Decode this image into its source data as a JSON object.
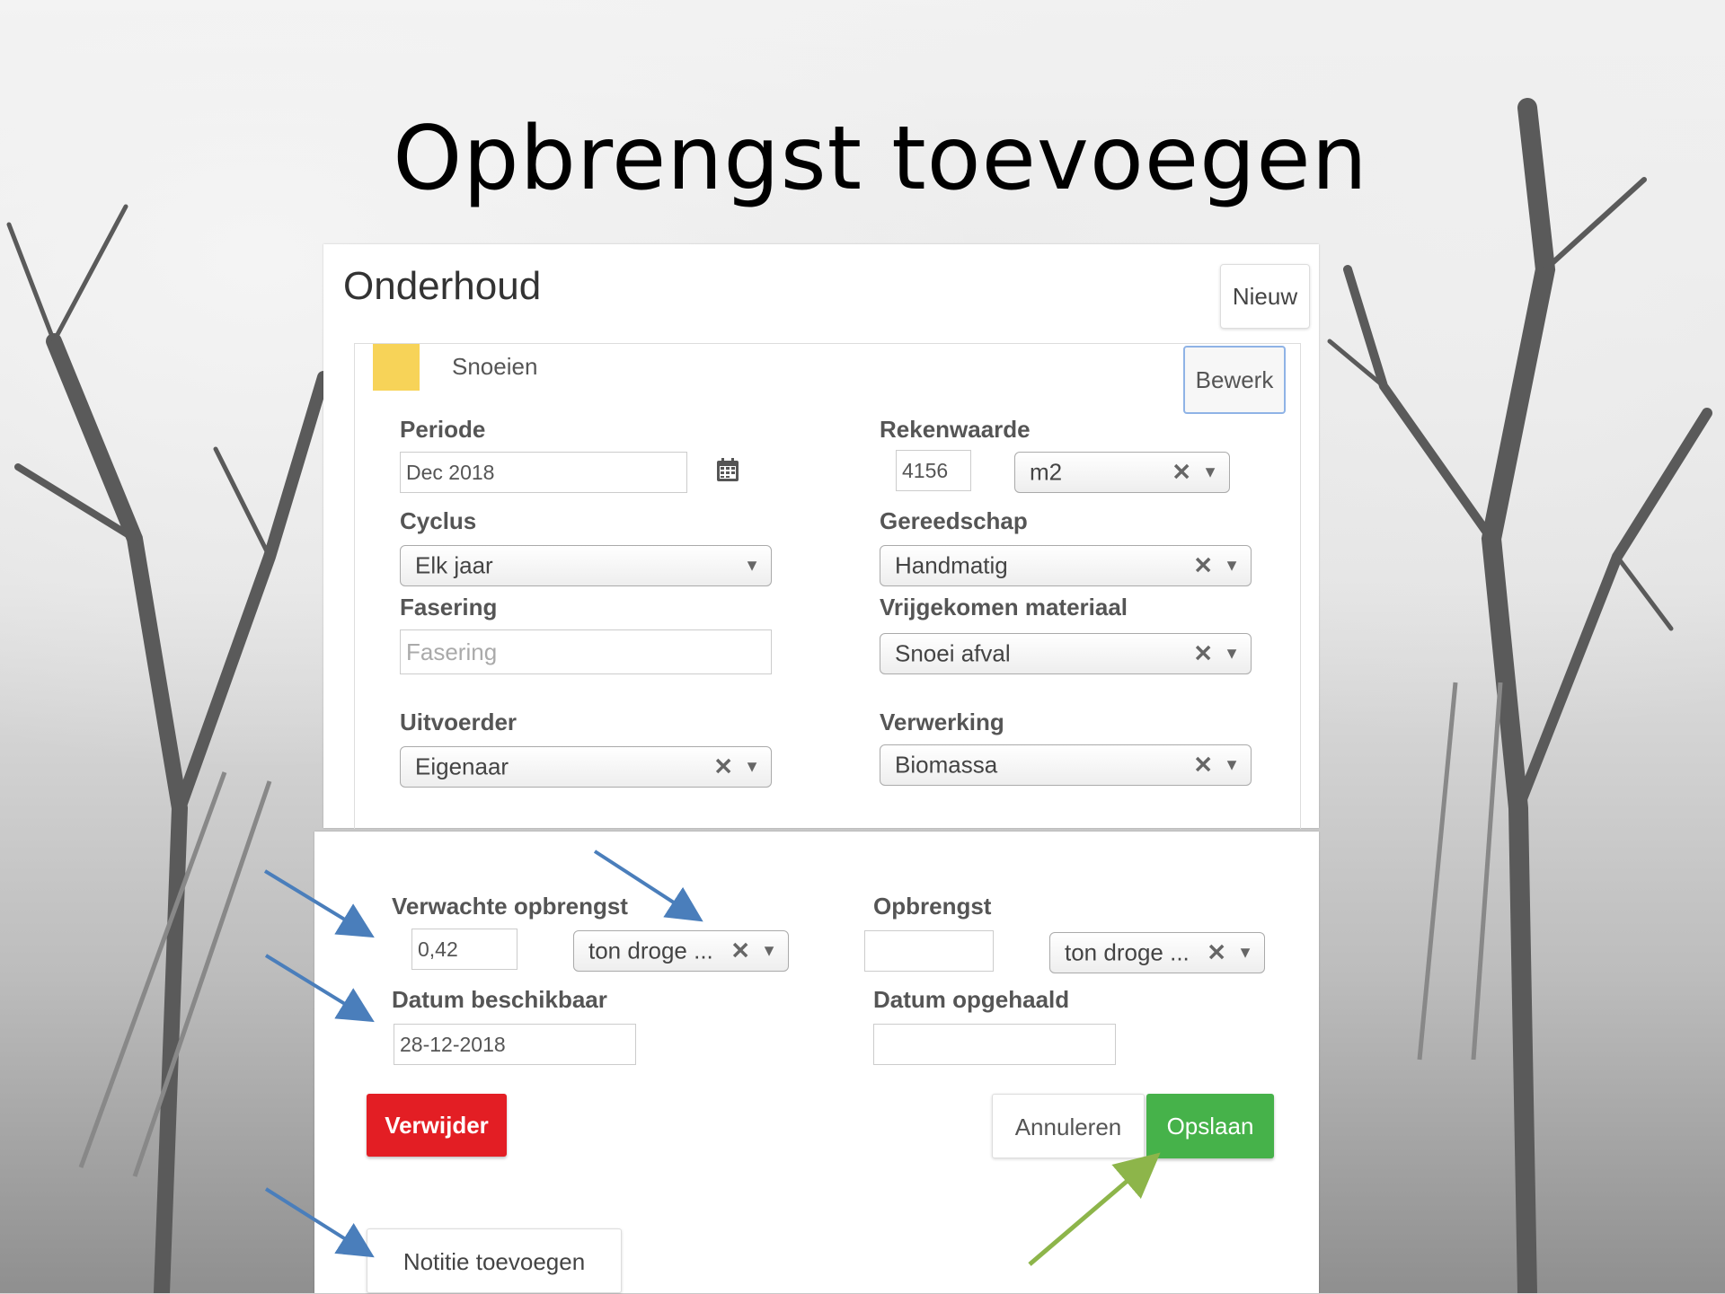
{
  "slide": {
    "title": "Opbrengst toevoegen"
  },
  "panel": {
    "title": "Onderhoud",
    "new_label": "Nieuw",
    "task_name": "Snoeien",
    "task_color": "#f7d358",
    "edit_label": "Bewerk"
  },
  "form": {
    "periode": {
      "label": "Periode",
      "value": "Dec 2018"
    },
    "rekenwaarde": {
      "label": "Rekenwaarde",
      "value": "4156",
      "unit": "m2"
    },
    "cyclus": {
      "label": "Cyclus",
      "value": "Elk jaar"
    },
    "gereedschap": {
      "label": "Gereedschap",
      "value": "Handmatig"
    },
    "fasering": {
      "label": "Fasering",
      "placeholder": "Fasering"
    },
    "vrijgekomen": {
      "label": "Vrijgekomen materiaal",
      "value": "Snoei afval"
    },
    "uitvoerder": {
      "label": "Uitvoerder",
      "value": "Eigenaar"
    },
    "verwerking": {
      "label": "Verwerking",
      "value": "Biomassa"
    },
    "verwachte_opbrengst": {
      "label": "Verwachte opbrengst",
      "value": "0,42",
      "unit": "ton droge ..."
    },
    "opbrengst": {
      "label": "Opbrengst",
      "value": "",
      "unit": "ton droge ..."
    },
    "datum_beschikbaar": {
      "label": "Datum beschikbaar",
      "value": "28-12-2018"
    },
    "datum_opgehaald": {
      "label": "Datum opgehaald",
      "value": ""
    }
  },
  "actions": {
    "delete_label": "Verwijder",
    "cancel_label": "Annuleren",
    "save_label": "Opslaan",
    "add_note_label": "Notitie toevoegen"
  },
  "icons": {
    "calendar": "calendar-icon",
    "clear": "clear-icon",
    "dropdown": "chevron-down-icon"
  },
  "colors": {
    "delete": "#e31e24",
    "save": "#46b24a",
    "arrow_blue": "#4a7ebb",
    "arrow_green": "#8db54a"
  }
}
